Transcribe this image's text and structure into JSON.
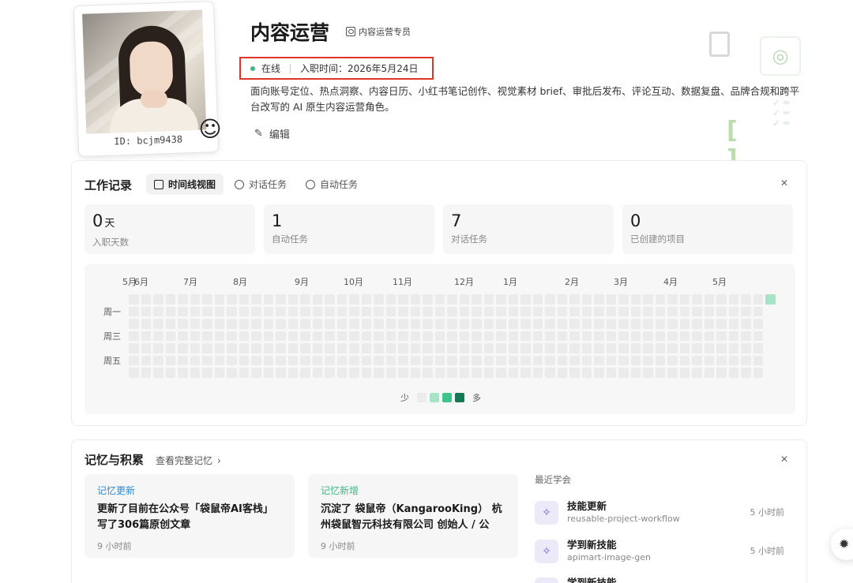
{
  "profile": {
    "name": "内容运营",
    "role": "内容运营专员",
    "id_label": "ID: bcjm9438",
    "status": "在线",
    "join_label": "入职时间：2026年5月24日",
    "description": "面向账号定位、热点洞察、内容日历、小红书笔记创作、视觉素材 brief、审批后发布、评论互动、数据复盘、品牌合规和跨平台改写的 AI 原生内容运营角色。",
    "edit_label": "编辑"
  },
  "work": {
    "title": "工作记录",
    "tabs": [
      {
        "label": "时间线视图",
        "icon": "calendar-icon"
      },
      {
        "label": "对话任务",
        "icon": "history-icon"
      },
      {
        "label": "自动任务",
        "icon": "clock-icon"
      }
    ],
    "stats": [
      {
        "value": "0",
        "unit": "天",
        "label": "入职天数"
      },
      {
        "value": "1",
        "unit": "",
        "label": "自动任务"
      },
      {
        "value": "7",
        "unit": "",
        "label": "对话任务"
      },
      {
        "value": "0",
        "unit": "",
        "label": "已创建的项目"
      }
    ],
    "heatmap": {
      "months": [
        "5月",
        "6月",
        "7月",
        "8月",
        "9月",
        "10月",
        "11月",
        "12月",
        "1月",
        "2月",
        "3月",
        "4月",
        "5月"
      ],
      "day_labels": [
        "周一",
        "周三",
        "周五"
      ],
      "legend_less": "少",
      "legend_more": "多",
      "legend_colors": [
        "#ebebeb",
        "#a7e3c7",
        "#3cc48b",
        "#137a55"
      ],
      "active_cell_color": "#a7e3c7"
    }
  },
  "memory": {
    "title": "记忆与积累",
    "view_all": "查看完整记忆",
    "cards": [
      {
        "tag": "记忆更新",
        "tag_color": "#2b8ad6",
        "text": "更新了目前在公众号「袋鼠帝AI客栈」写了306篇原创文章",
        "time": "9 小时前"
      },
      {
        "tag": "记忆新增",
        "tag_color": "#3fb883",
        "text": "沉淀了 袋鼠帝（KangarooKing） 杭州袋鼠智元科技有限公司 创始人 / 公众…",
        "time": "9 小时前"
      }
    ],
    "recent_label": "最近学会",
    "learned": [
      {
        "title": "技能更新",
        "sub": "reusable-project-workflow",
        "time": "5 小时前"
      },
      {
        "title": "学到新技能",
        "sub": "apimart-image-gen",
        "time": "5 小时前"
      },
      {
        "title": "学到新技能",
        "sub": "",
        "time": ""
      }
    ]
  }
}
